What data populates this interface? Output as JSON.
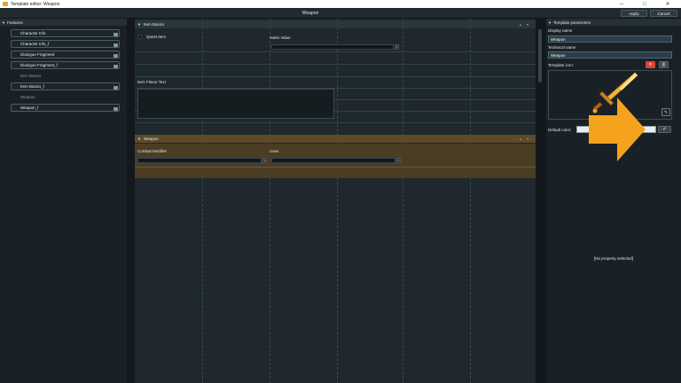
{
  "window": {
    "title": "Template editor: Weapon",
    "controls": [
      "─",
      "□",
      "✕"
    ]
  },
  "header": {
    "document_title": "Weapon",
    "apply_label": "Apply",
    "cancel_label": "Cancel"
  },
  "features_panel": {
    "title": "Features",
    "items": [
      {
        "label": "Character Info",
        "active": true
      },
      {
        "label": "Character Info_f",
        "active": true
      },
      {
        "label": "Dialogue Fragment",
        "active": true
      },
      {
        "label": "Dialogue Fragment_f",
        "active": true
      },
      {
        "label": "Item Basics",
        "active": false
      },
      {
        "label": "Item Basics_f",
        "active": true
      },
      {
        "label": "Weapon",
        "active": false
      },
      {
        "label": "Weapon_f",
        "active": true
      }
    ]
  },
  "editor": {
    "item_basics": {
      "title": "Item Basics",
      "quest_item_label": "Quest Item",
      "sales_value_label": "Sales Value",
      "flavor_text_label": "Item Flavor Text"
    },
    "weapon": {
      "title": "Weapon",
      "combat_modifier_label": "Combat Modifier",
      "uses_label": "Uses"
    },
    "section_controls": [
      "▴",
      "▾"
    ],
    "spin_glyph": "⇕"
  },
  "template_parameters": {
    "title": "Template parameters",
    "display_name_label": "Display name",
    "display_name_value": "Weapon",
    "technical_name_label": "Technical name",
    "technical_name_value": "Weapon",
    "template_icon_label": "Template icon:",
    "default_color_label": "Default color:",
    "default_color_value": "#e9eef0",
    "no_property_text": "[No property selected]",
    "icons": {
      "clear": "✕",
      "browse": "▥",
      "edit": "✎",
      "picker": "✐"
    }
  },
  "colors": {
    "accent_orange": "#f5a31c",
    "weapon_header": "#5f4a28",
    "clear_button": "#d9433a"
  }
}
